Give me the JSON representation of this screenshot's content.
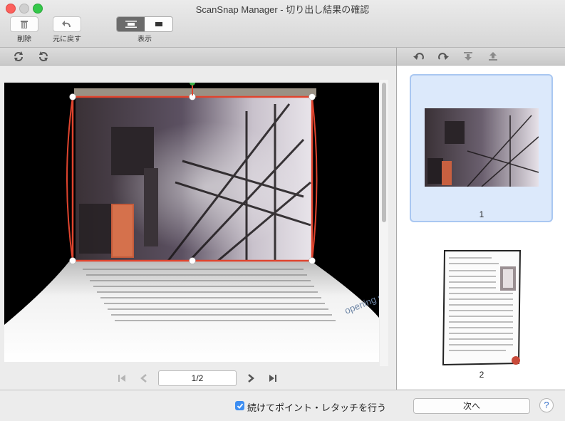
{
  "window": {
    "title": "ScanSnap Manager - 切り出し結果の確認"
  },
  "toolbar": {
    "delete_label": "削除",
    "undo_label": "元に戻す",
    "view_label": "表示"
  },
  "left_tools": {
    "icons": [
      "rotate-left-small-icon",
      "rotate-right-small-icon"
    ]
  },
  "preview": {
    "page_text_snippet": "opening second building"
  },
  "navigation": {
    "page_value": "1/2"
  },
  "right_tools": {
    "icons": [
      "rotate-ccw-icon",
      "rotate-cw-icon",
      "move-down-icon",
      "move-up-icon"
    ]
  },
  "thumbnails": [
    {
      "label": "1",
      "selected": true
    },
    {
      "label": "2",
      "selected": false
    }
  ],
  "footer": {
    "checkbox_label": "続けてポイント・レタッチを行う",
    "checkbox_checked": true,
    "next_label": "次へ",
    "help_label": "?"
  },
  "colors": {
    "crop_frame": "#e0442e",
    "selection_bg": "#dce9fb",
    "checkbox": "#3d8ef2"
  }
}
